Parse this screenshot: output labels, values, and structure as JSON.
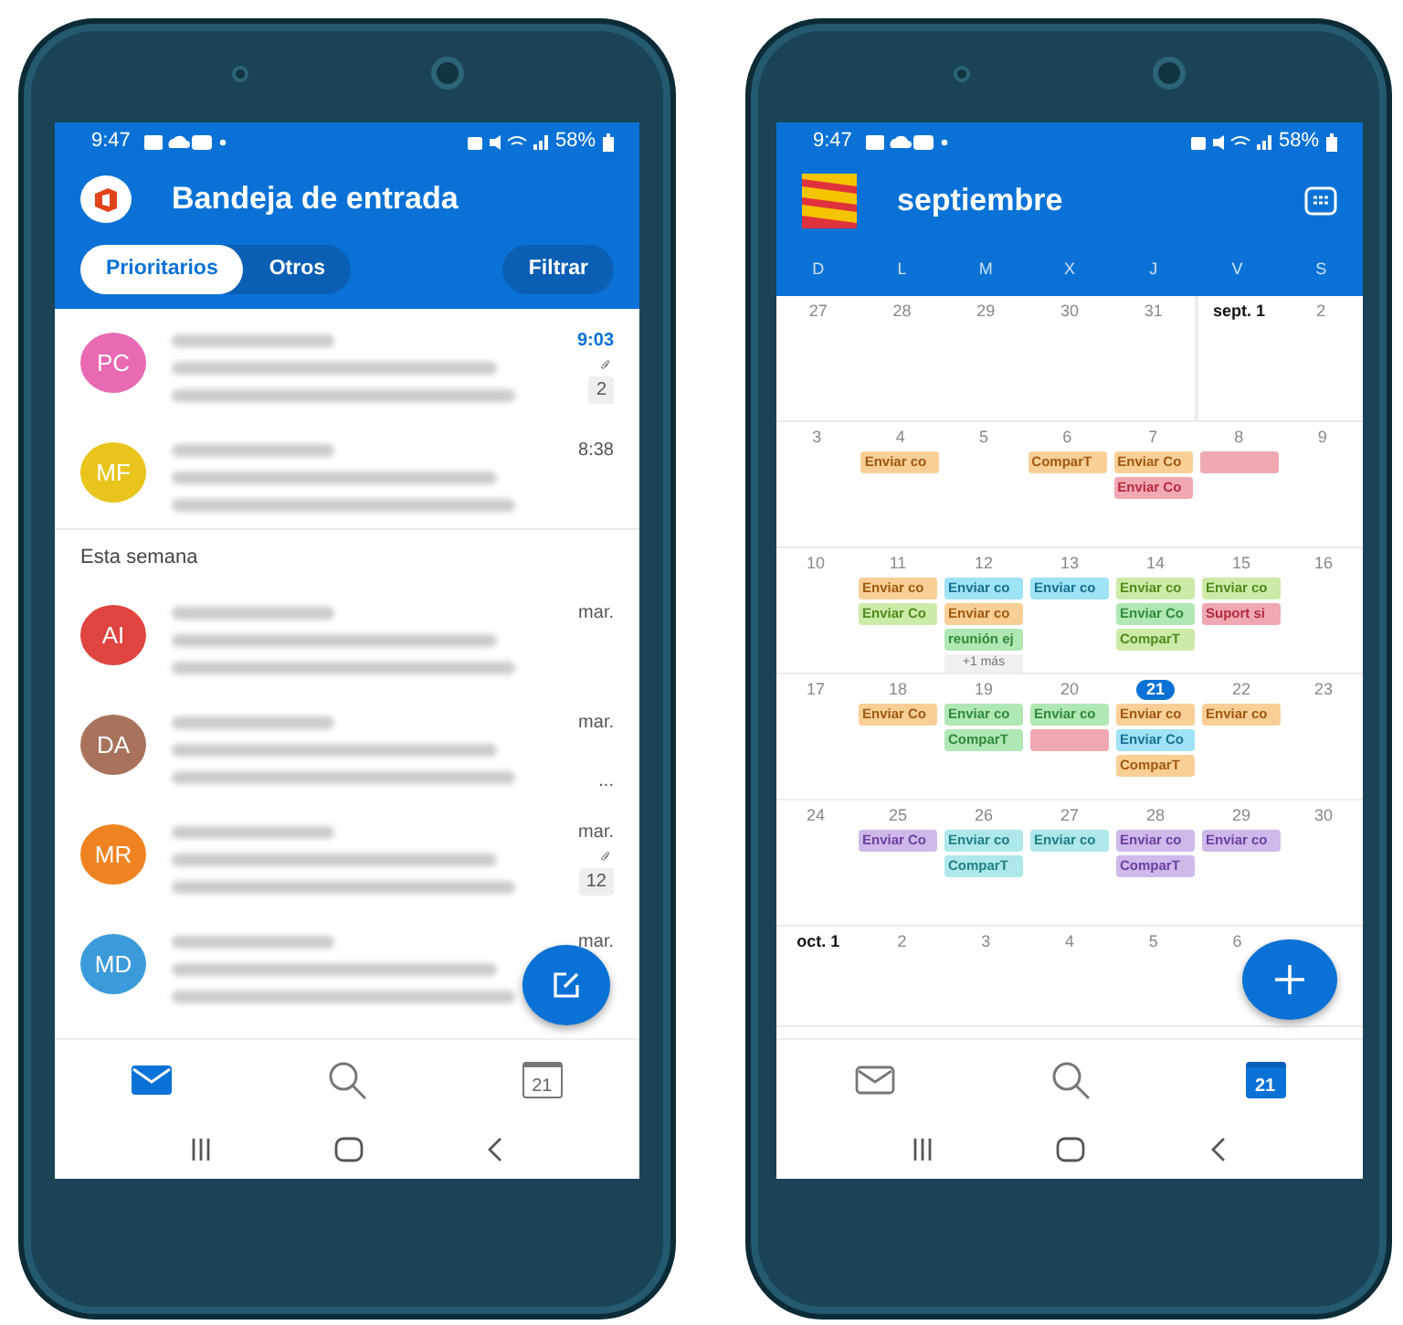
{
  "inbox_phone": {
    "status_bar": {
      "time": "9:47",
      "battery": "58%"
    },
    "title": "Bandeja de entrada",
    "tabs": [
      {
        "label": "Prioritarios",
        "selected": true
      },
      {
        "label": "Otros",
        "selected": false
      }
    ],
    "filter_button": "Filtrar",
    "sections": [
      {
        "messages": [
          {
            "initials": "PC",
            "color": "#e96ab3",
            "time": "9:03",
            "unread": true,
            "attachment": true,
            "count": "2"
          },
          {
            "initials": "MF",
            "color": "#e9c41c",
            "time": "8:38",
            "unread": false,
            "attachment": false
          }
        ]
      },
      {
        "heading": "Esta semana",
        "messages": [
          {
            "initials": "AI",
            "color": "#e0443f",
            "time": "mar.",
            "unread": false,
            "attachment": false
          },
          {
            "initials": "DA",
            "color": "#a8725c",
            "time": "mar.",
            "unread": false,
            "attachment": false,
            "ellipsis": "..."
          },
          {
            "initials": "MR",
            "color": "#ef8322",
            "time": "mar.",
            "unread": false,
            "attachment": true,
            "count": "12"
          },
          {
            "initials": "MD",
            "color": "#3b9bda",
            "time": "mar.",
            "unread": false,
            "attachment": false
          }
        ]
      }
    ],
    "bottom_nav": [
      {
        "kind": "mail",
        "selected": true
      },
      {
        "kind": "search",
        "selected": false
      },
      {
        "kind": "calendar",
        "label": "21",
        "selected": false
      }
    ]
  },
  "calendar_phone": {
    "status_bar": {
      "time": "9:47",
      "battery": "58%"
    },
    "title": "septiembre",
    "weekdays": [
      "D",
      "L",
      "M",
      "X",
      "J",
      "V",
      "S"
    ],
    "weeks": [
      {
        "days": [
          {
            "label": "27"
          },
          {
            "label": "28"
          },
          {
            "label": "29"
          },
          {
            "label": "30"
          },
          {
            "label": "31"
          },
          {
            "label": "sept. 1",
            "bold": true
          },
          {
            "label": "2"
          }
        ]
      },
      {
        "days": [
          {
            "label": "3"
          },
          {
            "label": "4",
            "events": [
              {
                "label": "Enviar co",
                "color": "#f9cf97"
              }
            ]
          },
          {
            "label": "5"
          },
          {
            "label": "6",
            "events": [
              {
                "label": "ComparT",
                "color": "#f9cf97"
              }
            ]
          },
          {
            "label": "7",
            "events": [
              {
                "label": "Enviar Co",
                "color": "#f9cf97"
              },
              {
                "label": "Enviar Co",
                "color": "#f0a9b3"
              }
            ]
          },
          {
            "label": "8",
            "events": [
              {
                "color": "#f0a9b3"
              }
            ]
          },
          {
            "label": "9"
          }
        ]
      },
      {
        "days": [
          {
            "label": "10"
          },
          {
            "label": "11",
            "events": [
              {
                "label": "Enviar co",
                "color": "#f9cf97"
              },
              {
                "label": "Enviar Co",
                "color": "#cdeba8"
              }
            ]
          },
          {
            "label": "12",
            "events": [
              {
                "label": "Enviar co",
                "color": "#9fe3f7"
              },
              {
                "label": "Enviar co",
                "color": "#f9cf97"
              },
              {
                "label": "reunión ej",
                "color": "#b0e8b5"
              }
            ],
            "more": "+1 más"
          },
          {
            "label": "13",
            "events": [
              {
                "label": "Enviar co",
                "color": "#9fe3f7"
              }
            ]
          },
          {
            "label": "14",
            "events": [
              {
                "label": "Enviar co",
                "color": "#cdeba8"
              },
              {
                "label": "Enviar Co",
                "color": "#b0e8b5"
              },
              {
                "label": "ComparT",
                "color": "#cdeba8"
              }
            ]
          },
          {
            "label": "15",
            "events": [
              {
                "label": "Enviar co",
                "color": "#cdeba8"
              },
              {
                "label": "Suport si",
                "color": "#f0a9b3"
              }
            ]
          },
          {
            "label": "16"
          }
        ]
      },
      {
        "days": [
          {
            "label": "17"
          },
          {
            "label": "18",
            "events": [
              {
                "label": "Enviar Co",
                "color": "#f9cf97"
              }
            ]
          },
          {
            "label": "19",
            "events": [
              {
                "label": "Enviar co",
                "color": "#b0e8b5"
              },
              {
                "label": "ComparT",
                "color": "#b0e8b5"
              }
            ]
          },
          {
            "label": "20",
            "events": [
              {
                "label": "Enviar co",
                "color": "#b0e8b5"
              },
              {
                "color": "#f0a9b3"
              }
            ]
          },
          {
            "label": "21",
            "today": true,
            "events": [
              {
                "label": "Enviar co",
                "color": "#f9cf97"
              },
              {
                "label": "Enviar Co",
                "color": "#9fe3f7"
              },
              {
                "label": "ComparT",
                "color": "#f9cf97"
              }
            ]
          },
          {
            "label": "22",
            "events": [
              {
                "label": "Enviar co",
                "color": "#f9cf97"
              }
            ]
          },
          {
            "label": "23"
          }
        ]
      },
      {
        "days": [
          {
            "label": "24"
          },
          {
            "label": "25",
            "events": [
              {
                "label": "Enviar Co",
                "color": "#cfb9ea"
              }
            ]
          },
          {
            "label": "26",
            "events": [
              {
                "label": "Enviar co",
                "color": "#aee8ea"
              },
              {
                "label": "ComparT",
                "color": "#aee8ea"
              }
            ]
          },
          {
            "label": "27",
            "events": [
              {
                "label": "Enviar co",
                "color": "#aee8ea"
              }
            ]
          },
          {
            "label": "28",
            "events": [
              {
                "label": "Enviar co",
                "color": "#cfb9ea"
              },
              {
                "label": "ComparT",
                "color": "#cfb9ea"
              }
            ]
          },
          {
            "label": "29",
            "events": [
              {
                "label": "Enviar co",
                "color": "#cfb9ea"
              }
            ]
          },
          {
            "label": "30"
          }
        ]
      },
      {
        "days": [
          {
            "label": "oct. 1",
            "bold": true
          },
          {
            "label": "2"
          },
          {
            "label": "3"
          },
          {
            "label": "4"
          },
          {
            "label": "5"
          },
          {
            "label": "6"
          }
        ]
      }
    ],
    "bottom_nav": [
      {
        "kind": "mail",
        "selected": false
      },
      {
        "kind": "search",
        "selected": false
      },
      {
        "kind": "calendar",
        "label": "21",
        "selected": true
      }
    ]
  }
}
